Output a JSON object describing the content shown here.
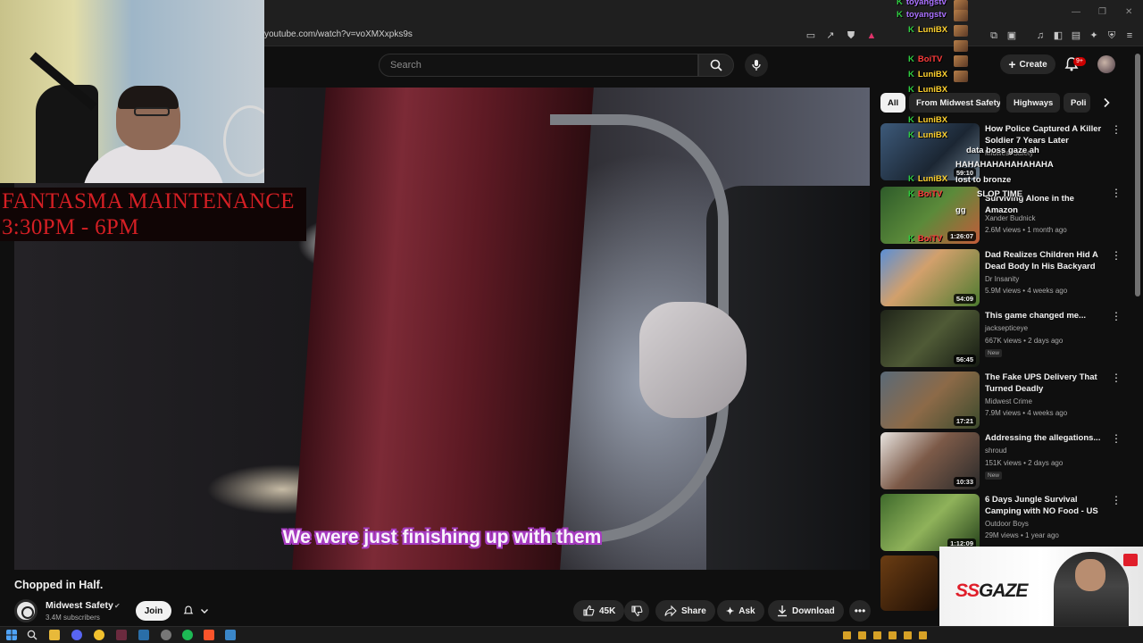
{
  "browser": {
    "url": "youtube.com/watch?v=voXMXxpks9s"
  },
  "header": {
    "search_placeholder": "Search",
    "create_label": "Create",
    "notifications_badge": "9+"
  },
  "webcam_overlay": {
    "title_line1": "FANTASMA MAINTENANCE",
    "title_line2": "3:30PM - 6PM"
  },
  "video": {
    "subtitle": "We were just finishing up with them",
    "title": "Chopped in Half."
  },
  "channel": {
    "name": "Midwest Safety",
    "subscribers": "3.4M subscribers",
    "join_label": "Join"
  },
  "actions": {
    "likes": "45K",
    "share_label": "Share",
    "ask_label": "Ask",
    "download_label": "Download"
  },
  "chips": [
    "All",
    "From Midwest Safety",
    "Highways",
    "Poli"
  ],
  "recommendations": [
    {
      "title": "How Police Captured A Killer Soldier 7 Years Later",
      "channel": "Midwest Safety",
      "meta": "",
      "duration": "59:10",
      "new": ""
    },
    {
      "title": "Surviving Alone in the Amazon",
      "channel": "Xander Budnick",
      "meta": "2.6M views • 1 month ago",
      "duration": "1:26:07",
      "new": ""
    },
    {
      "title": "Dad Realizes Children Hid A Dead Body In His Backyard",
      "channel": "Dr Insanity",
      "meta": "5.9M views • 4 weeks ago",
      "duration": "54:09",
      "new": ""
    },
    {
      "title": "This game changed me...",
      "channel": "jacksepticeye",
      "meta": "667K views • 2 days ago",
      "duration": "56:45",
      "new": "New"
    },
    {
      "title": "The Fake UPS Delivery That Turned Deadly",
      "channel": "Midwest Crime",
      "meta": "7.9M views • 4 weeks ago",
      "duration": "17:21",
      "new": ""
    },
    {
      "title": "Addressing the allegations...",
      "channel": "shroud",
      "meta": "151K views • 2 days ago",
      "duration": "10:33",
      "new": "New"
    },
    {
      "title": "6 Days Jungle Survival Camping with NO Food - US Marine Cor...",
      "channel": "Outdoor Boys",
      "meta": "29M views • 1 year ago",
      "duration": "1:12:09",
      "new": ""
    }
  ],
  "chat": {
    "names": [
      {
        "name": "toyangstv",
        "color": "#a970ff"
      },
      {
        "name": "LuniBX",
        "color": "#ffd22e"
      },
      {
        "name": "BoiTV",
        "color": "#ff3b3b"
      },
      {
        "name": "LuniBX",
        "color": "#ffd22e"
      },
      {
        "name": "LuniBX",
        "color": "#ffd22e"
      },
      {
        "name": "LuniBX",
        "color": "#ffd22e"
      },
      {
        "name": "LuniBX",
        "color": "#ffd22e"
      },
      {
        "name": "LuniBX",
        "color": "#ffd22e"
      },
      {
        "name": "BoiTV",
        "color": "#ff3b3b"
      },
      {
        "name": "BoiTV",
        "color": "#ff3b3b"
      }
    ],
    "messages": [
      "data boss gaze ah",
      "HAHAHAHAHAHAHAHA",
      "lost to bronze",
      "SLOP TIME",
      "gg"
    ]
  },
  "sponsor": {
    "text_a": "SS",
    "text_b": "GAZE"
  },
  "colors": {
    "accent_red": "#cc0000",
    "chat_badge_green": "#2ecc40",
    "subtitle_outline": "#a63bc0",
    "maintenance_red": "#d41f24"
  }
}
